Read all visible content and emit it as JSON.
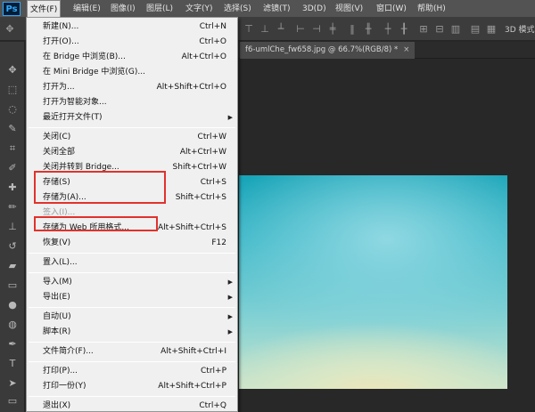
{
  "app": {
    "logo_text": "Ps"
  },
  "menubar": {
    "items": [
      {
        "label": "文件(F)",
        "active": true
      },
      {
        "label": "编辑(E)"
      },
      {
        "label": "图像(I)"
      },
      {
        "label": "图层(L)"
      },
      {
        "label": "文字(Y)"
      },
      {
        "label": "选择(S)"
      },
      {
        "label": "滤镜(T)"
      },
      {
        "label": "3D(D)"
      },
      {
        "label": "视图(V)"
      },
      {
        "label": "窗口(W)"
      },
      {
        "label": "帮助(H)"
      }
    ]
  },
  "optionsbar": {
    "right_label": "3D 模式"
  },
  "document": {
    "tab_title": "f6-umlChe_fw658.jpg @ 66.7%(RGB/8) *",
    "close_glyph": "×"
  },
  "file_menu": {
    "items": [
      {
        "label": "新建(N)...",
        "shortcut": "Ctrl+N"
      },
      {
        "label": "打开(O)...",
        "shortcut": "Ctrl+O"
      },
      {
        "label": "在 Bridge 中浏览(B)...",
        "shortcut": "Alt+Ctrl+O"
      },
      {
        "label": "在 Mini Bridge 中浏览(G)...",
        "shortcut": ""
      },
      {
        "label": "打开为...",
        "shortcut": "Alt+Shift+Ctrl+O"
      },
      {
        "label": "打开为智能对象...",
        "shortcut": ""
      },
      {
        "label": "最近打开文件(T)",
        "shortcut": "",
        "submenu": true
      },
      {
        "label": "关闭(C)",
        "shortcut": "Ctrl+W"
      },
      {
        "label": "关闭全部",
        "shortcut": "Alt+Ctrl+W"
      },
      {
        "label": "关闭并转到 Bridge...",
        "shortcut": "Shift+Ctrl+W"
      },
      {
        "label": "存储(S)",
        "shortcut": "Ctrl+S"
      },
      {
        "label": "存储为(A)...",
        "shortcut": "Shift+Ctrl+S"
      },
      {
        "label": "签入(I)...",
        "shortcut": "",
        "disabled": true
      },
      {
        "label": "存储为 Web 所用格式...",
        "shortcut": "Alt+Shift+Ctrl+S"
      },
      {
        "label": "恢复(V)",
        "shortcut": "F12"
      },
      {
        "label": "置入(L)...",
        "shortcut": ""
      },
      {
        "label": "导入(M)",
        "shortcut": "",
        "submenu": true
      },
      {
        "label": "导出(E)",
        "shortcut": "",
        "submenu": true
      },
      {
        "label": "自动(U)",
        "shortcut": "",
        "submenu": true
      },
      {
        "label": "脚本(R)",
        "shortcut": "",
        "submenu": true
      },
      {
        "label": "文件简介(F)...",
        "shortcut": "Alt+Shift+Ctrl+I"
      },
      {
        "label": "打印(P)...",
        "shortcut": "Ctrl+P"
      },
      {
        "label": "打印一份(Y)",
        "shortcut": "Alt+Shift+Ctrl+P"
      },
      {
        "label": "退出(X)",
        "shortcut": "Ctrl+Q"
      }
    ],
    "submenu_glyph": "▶"
  },
  "colors": {
    "menu_bg": "#f0f0f0",
    "highlight_box": "#e0322d",
    "photo_teal": "#17a4b8"
  },
  "tools": [
    "move-tool",
    "marquee-tool",
    "lasso-tool",
    "quick-select-tool",
    "crop-tool",
    "eyedropper-tool",
    "healing-brush-tool",
    "brush-tool",
    "clone-stamp-tool",
    "history-brush-tool",
    "eraser-tool",
    "gradient-tool",
    "blur-tool",
    "dodge-tool",
    "pen-tool",
    "type-tool",
    "path-select-tool",
    "shape-tool",
    "hand-tool"
  ]
}
